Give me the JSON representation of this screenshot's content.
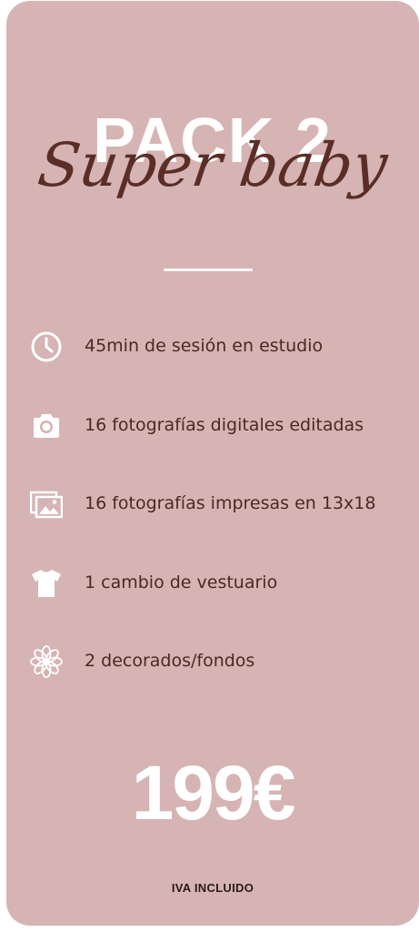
{
  "header": {
    "pack_title": "PACK 2",
    "script_title": "Super baby"
  },
  "features": [
    {
      "icon": "clock-icon",
      "label": "45min de sesión en estudio"
    },
    {
      "icon": "camera-icon",
      "label": "16 fotografías digitales editadas"
    },
    {
      "icon": "photo-prints-icon",
      "label": "16 fotografías impresas en 13x18"
    },
    {
      "icon": "tshirt-icon",
      "label": "1 cambio de vestuario"
    },
    {
      "icon": "flower-icon",
      "label": "2 decorados/fondos"
    }
  ],
  "price": {
    "amount": "199€",
    "tax_note": "IVA INCLUIDO"
  },
  "colors": {
    "card_background": "#d6b4b4",
    "script_color": "#5a2e26",
    "text_color": "#4a2824",
    "accent_white": "#ffffff"
  }
}
